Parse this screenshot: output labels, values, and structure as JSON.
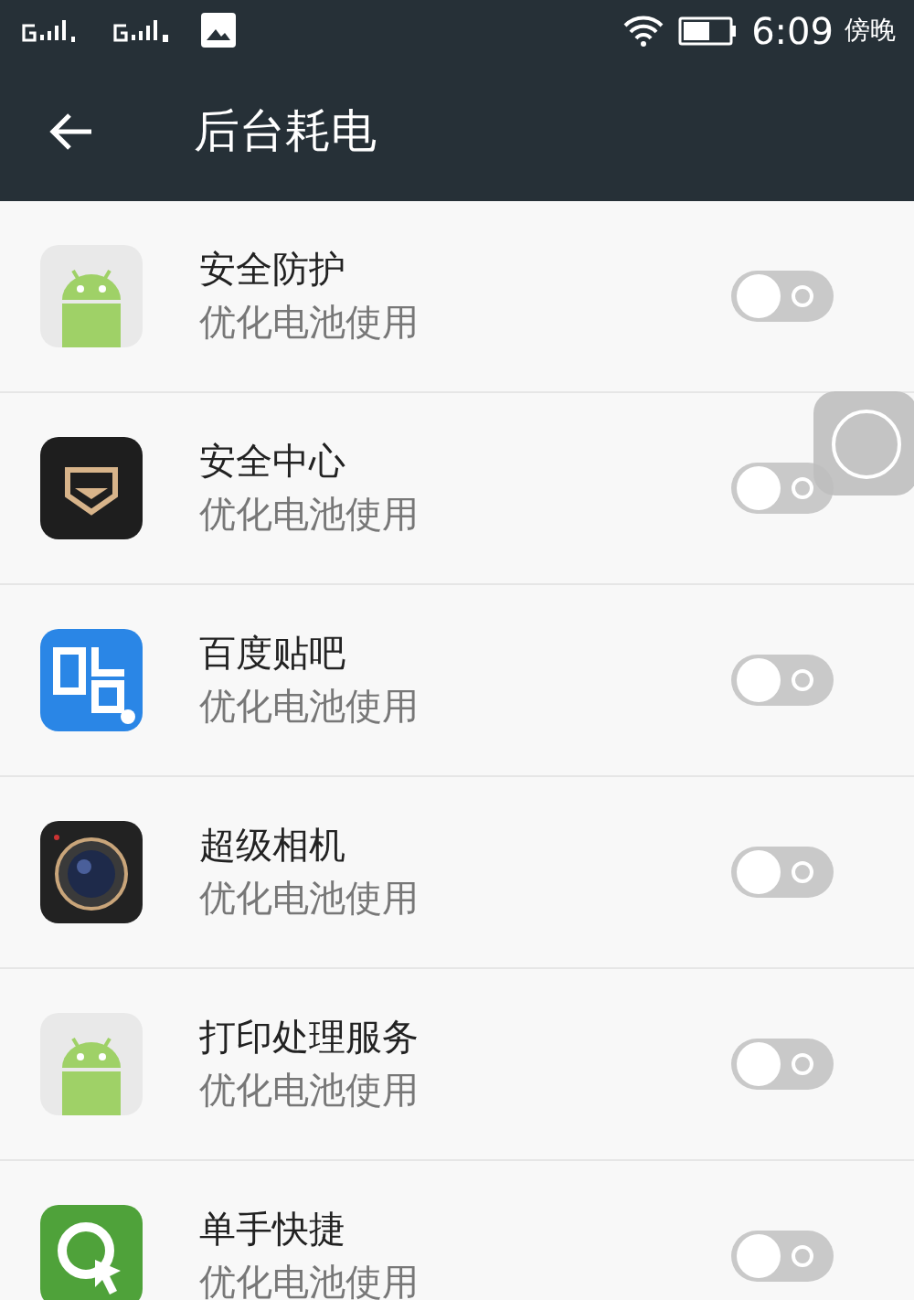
{
  "status_bar": {
    "time": "6:09",
    "period": "傍晚"
  },
  "toolbar": {
    "title": "后台耗电"
  },
  "apps": [
    {
      "name": "安全防护",
      "subtitle": "优化电池使用",
      "kind": "android",
      "on": false
    },
    {
      "name": "安全中心",
      "subtitle": "优化电池使用",
      "kind": "shield",
      "on": false
    },
    {
      "name": "百度贴吧",
      "subtitle": "优化电池使用",
      "kind": "tieba",
      "on": false
    },
    {
      "name": "超级相机",
      "subtitle": "优化电池使用",
      "kind": "camera",
      "on": false
    },
    {
      "name": "打印处理服务",
      "subtitle": "优化电池使用",
      "kind": "android",
      "on": false
    },
    {
      "name": "单手快捷",
      "subtitle": "优化电池使用",
      "kind": "gesture",
      "on": false
    }
  ]
}
